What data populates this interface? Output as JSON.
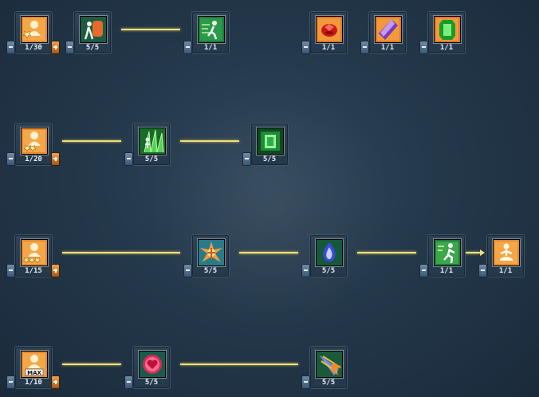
{
  "skills": [
    {
      "id": "r1s1",
      "icon": "passive-stars-icon",
      "stars": 1,
      "level": "1/30",
      "has_plus": true
    },
    {
      "id": "r1s2",
      "icon": "stone-skin-icon",
      "level": "5/5"
    },
    {
      "id": "r1s3",
      "icon": "dash-icon",
      "level": "1/1"
    },
    {
      "id": "r1s4",
      "icon": "red-gem-icon",
      "level": "1/1"
    },
    {
      "id": "r1s5",
      "icon": "purple-crystal-icon",
      "level": "1/1"
    },
    {
      "id": "r1s6",
      "icon": "green-crystal-icon",
      "level": "1/1"
    },
    {
      "id": "r2s1",
      "icon": "passive-stars-icon",
      "stars": 2,
      "level": "1/20",
      "has_plus": true
    },
    {
      "id": "r2s2",
      "icon": "green-aura-icon",
      "level": "5/5"
    },
    {
      "id": "r2s3",
      "icon": "green-cube-icon",
      "level": "5/5"
    },
    {
      "id": "r3s1",
      "icon": "passive-stars-icon",
      "stars": 3,
      "level": "1/15",
      "has_plus": true
    },
    {
      "id": "r3s2",
      "icon": "burst-icon",
      "level": "5/5"
    },
    {
      "id": "r3s3",
      "icon": "blue-flame-icon",
      "level": "5/5"
    },
    {
      "id": "r3s4",
      "icon": "run-icon",
      "level": "1/1"
    },
    {
      "id": "r3s5",
      "icon": "meditate-icon",
      "level": "1/1"
    },
    {
      "id": "r4s1",
      "icon": "passive-max-icon",
      "badge": "MAX",
      "level": "1/10",
      "has_plus": true
    },
    {
      "id": "r4s2",
      "icon": "heart-icon",
      "level": "5/5"
    },
    {
      "id": "r4s3",
      "icon": "feather-burst-icon",
      "level": "5/5"
    }
  ],
  "colors": {
    "connector": "#f0e07a",
    "passive_bg": "#e48a2b",
    "green_bg": "#1f7a3a",
    "red_bg": "#d45a1a",
    "purple_bg": "#c67c2c"
  }
}
